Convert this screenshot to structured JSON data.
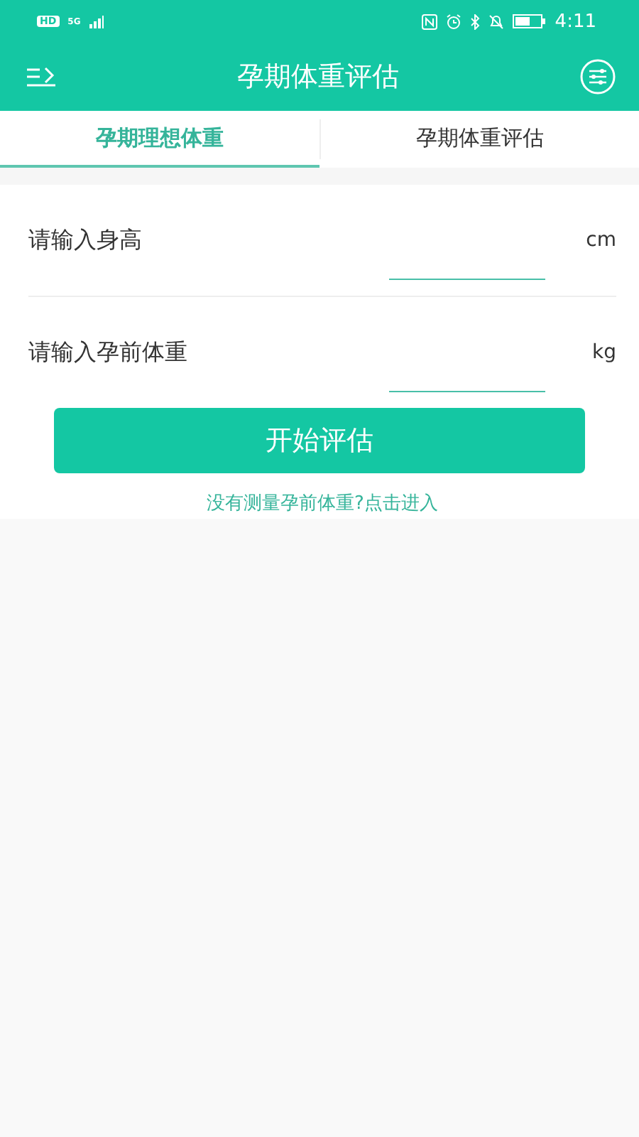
{
  "status_bar": {
    "badges": [
      "HD",
      "5G"
    ],
    "time": "4:11"
  },
  "header": {
    "title": "孕期体重评估"
  },
  "tabs": [
    {
      "label": "孕期理想体重",
      "selected": true
    },
    {
      "label": "孕期体重评估",
      "selected": false
    }
  ],
  "fields": [
    {
      "label": "请输入身高",
      "unit": "cm"
    },
    {
      "label": "请输入孕前体重",
      "unit": "kg"
    }
  ],
  "submit_button": "开始评估",
  "link": "没有测量孕前体重?点击进入"
}
